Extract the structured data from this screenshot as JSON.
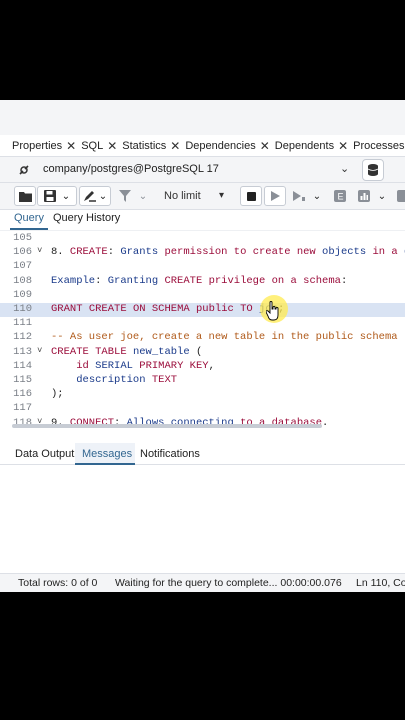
{
  "tabs": [
    {
      "label": "Properties"
    },
    {
      "label": "SQL"
    },
    {
      "label": "Statistics"
    },
    {
      "label": "Dependencies"
    },
    {
      "label": "Dependents"
    },
    {
      "label": "Processes"
    }
  ],
  "connection": {
    "label": "company/postgres@PostgreSQL 17"
  },
  "toolbar": {
    "limit_label": "No limit"
  },
  "subtabs": {
    "query": "Query",
    "history": "Query History"
  },
  "editor": {
    "lines": [
      {
        "num": "105",
        "tokens": []
      },
      {
        "num": "106",
        "fold": "˅",
        "tokens": [
          {
            "t": "8. ",
            "c": "tx"
          },
          {
            "t": "CREATE",
            "c": "kw"
          },
          {
            "t": ": ",
            "c": "tx"
          },
          {
            "t": "Grants",
            "c": "id"
          },
          {
            "t": " ",
            "c": "tx"
          },
          {
            "t": "permission",
            "c": "kw"
          },
          {
            "t": " ",
            "c": "tx"
          },
          {
            "t": "to",
            "c": "kw"
          },
          {
            "t": " ",
            "c": "tx"
          },
          {
            "t": "create",
            "c": "kw"
          },
          {
            "t": " ",
            "c": "tx"
          },
          {
            "t": "new",
            "c": "kw"
          },
          {
            "t": " ",
            "c": "tx"
          },
          {
            "t": "objects",
            "c": "id"
          },
          {
            "t": " ",
            "c": "tx"
          },
          {
            "t": "in",
            "c": "kw"
          },
          {
            "t": " ",
            "c": "tx"
          },
          {
            "t": "a",
            "c": "kw"
          },
          {
            "t": " ",
            "c": "tx"
          },
          {
            "t": "da",
            "c": "id"
          }
        ]
      },
      {
        "num": "107",
        "tokens": []
      },
      {
        "num": "108",
        "tokens": [
          {
            "t": "Example",
            "c": "id"
          },
          {
            "t": ": ",
            "c": "tx"
          },
          {
            "t": "Granting",
            "c": "id"
          },
          {
            "t": " ",
            "c": "tx"
          },
          {
            "t": "CREATE",
            "c": "kw"
          },
          {
            "t": " ",
            "c": "tx"
          },
          {
            "t": "privilege",
            "c": "kw"
          },
          {
            "t": " ",
            "c": "tx"
          },
          {
            "t": "on",
            "c": "kw"
          },
          {
            "t": " ",
            "c": "tx"
          },
          {
            "t": "a",
            "c": "kw"
          },
          {
            "t": " ",
            "c": "tx"
          },
          {
            "t": "schema",
            "c": "kw"
          },
          {
            "t": ":",
            "c": "tx"
          }
        ]
      },
      {
        "num": "109",
        "tokens": []
      },
      {
        "num": "110",
        "hl": true,
        "tokens": [
          {
            "t": "GRANT",
            "c": "kw"
          },
          {
            "t": " ",
            "c": "tx"
          },
          {
            "t": "CREATE",
            "c": "kw"
          },
          {
            "t": " ",
            "c": "tx"
          },
          {
            "t": "ON",
            "c": "kw"
          },
          {
            "t": " ",
            "c": "tx"
          },
          {
            "t": "SCHEMA",
            "c": "kw"
          },
          {
            "t": " ",
            "c": "tx"
          },
          {
            "t": "public",
            "c": "kw"
          },
          {
            "t": " ",
            "c": "tx"
          },
          {
            "t": "TO",
            "c": "kw"
          },
          {
            "t": " ",
            "c": "tx"
          },
          {
            "t": "joe",
            "c": "id"
          },
          {
            "t": ";",
            "c": "tx"
          }
        ]
      },
      {
        "num": "111",
        "tokens": []
      },
      {
        "num": "112",
        "tokens": [
          {
            "t": "-- As user joe, create a new table in the public schema",
            "c": "cm"
          }
        ]
      },
      {
        "num": "113",
        "fold": "˅",
        "tokens": [
          {
            "t": "CREATE",
            "c": "kw"
          },
          {
            "t": " ",
            "c": "tx"
          },
          {
            "t": "TABLE",
            "c": "kw"
          },
          {
            "t": " ",
            "c": "tx"
          },
          {
            "t": "new_table",
            "c": "id"
          },
          {
            "t": " (",
            "c": "tx"
          }
        ]
      },
      {
        "num": "114",
        "tokens": [
          {
            "t": "    ",
            "c": "tx"
          },
          {
            "t": "id",
            "c": "kw"
          },
          {
            "t": " ",
            "c": "tx"
          },
          {
            "t": "SERIAL",
            "c": "id"
          },
          {
            "t": " ",
            "c": "tx"
          },
          {
            "t": "PRIMARY KEY",
            "c": "kw"
          },
          {
            "t": ",",
            "c": "tx"
          }
        ]
      },
      {
        "num": "115",
        "tokens": [
          {
            "t": "    ",
            "c": "tx"
          },
          {
            "t": "description",
            "c": "id"
          },
          {
            "t": " ",
            "c": "tx"
          },
          {
            "t": "TEXT",
            "c": "kw"
          }
        ]
      },
      {
        "num": "116",
        "tokens": [
          {
            "t": ");",
            "c": "tx"
          }
        ]
      },
      {
        "num": "117",
        "tokens": []
      },
      {
        "num": "118",
        "fold": "˅",
        "tokens": [
          {
            "t": "9. ",
            "c": "tx"
          },
          {
            "t": "CONNECT",
            "c": "kw"
          },
          {
            "t": ": ",
            "c": "tx"
          },
          {
            "t": "Allows",
            "c": "id"
          },
          {
            "t": " ",
            "c": "tx"
          },
          {
            "t": "connecting",
            "c": "id"
          },
          {
            "t": " ",
            "c": "tx"
          },
          {
            "t": "to",
            "c": "kw"
          },
          {
            "t": " ",
            "c": "tx"
          },
          {
            "t": "a",
            "c": "kw"
          },
          {
            "t": " ",
            "c": "tx"
          },
          {
            "t": "database",
            "c": "kw"
          },
          {
            "t": ".",
            "c": "tx"
          }
        ]
      }
    ]
  },
  "output_tabs": {
    "data_output": "Data Output",
    "messages": "Messages",
    "notifications": "Notifications"
  },
  "status": {
    "rows": "Total rows: 0 of 0",
    "message": "Waiting for the query to complete... 00:00:00.076",
    "position": "Ln 110, Co"
  }
}
